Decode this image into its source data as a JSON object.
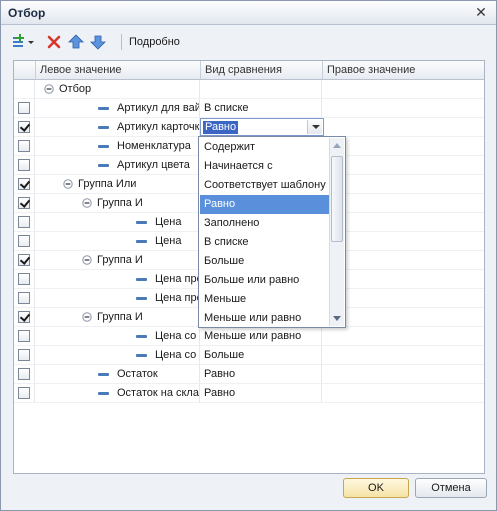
{
  "window": {
    "title": "Отбор"
  },
  "toolbar": {
    "details_label": "Подробно"
  },
  "grid": {
    "columns": [
      "Левое значение",
      "Вид сравнения",
      "Правое значение"
    ],
    "rows": [
      {
        "level": 0,
        "kind": "group",
        "expand": "collapse",
        "checkbox": false,
        "checked": false,
        "left": "Отбор",
        "cmp": ""
      },
      {
        "level": 1,
        "kind": "item",
        "checkbox": true,
        "checked": false,
        "left": "Артикул для вайлд...",
        "cmp": "В списке"
      },
      {
        "level": 1,
        "kind": "item",
        "checkbox": true,
        "checked": true,
        "left": "Артикул карточки",
        "cmp": "Равно",
        "editing": true
      },
      {
        "level": 1,
        "kind": "item",
        "checkbox": true,
        "checked": false,
        "left": "Номенклатура",
        "cmp": ""
      },
      {
        "level": 1,
        "kind": "item",
        "checkbox": true,
        "checked": false,
        "left": "Артикул цвета",
        "cmp": ""
      },
      {
        "level": 1,
        "kind": "group",
        "expand": "collapse",
        "checkbox": true,
        "checked": true,
        "left": "Группа Или",
        "cmp": ""
      },
      {
        "level": 2,
        "kind": "group",
        "expand": "collapse",
        "checkbox": true,
        "checked": true,
        "left": "Группа И",
        "cmp": ""
      },
      {
        "level": 3,
        "kind": "item",
        "checkbox": true,
        "checked": false,
        "left": "Цена",
        "cmp": ""
      },
      {
        "level": 3,
        "kind": "item",
        "checkbox": true,
        "checked": false,
        "left": "Цена",
        "cmp": ""
      },
      {
        "level": 2,
        "kind": "group",
        "expand": "collapse",
        "checkbox": true,
        "checked": true,
        "left": "Группа И",
        "cmp": ""
      },
      {
        "level": 3,
        "kind": "item",
        "checkbox": true,
        "checked": false,
        "left": "Цена про...",
        "cmp": ""
      },
      {
        "level": 3,
        "kind": "item",
        "checkbox": true,
        "checked": false,
        "left": "Цена про...",
        "cmp": ""
      },
      {
        "level": 2,
        "kind": "group",
        "expand": "collapse",
        "checkbox": true,
        "checked": true,
        "left": "Группа И",
        "cmp": ""
      },
      {
        "level": 3,
        "kind": "item",
        "checkbox": true,
        "checked": false,
        "left": "Цена со с...",
        "cmp": "Меньше или равно"
      },
      {
        "level": 3,
        "kind": "item",
        "checkbox": true,
        "checked": false,
        "left": "Цена со с...",
        "cmp": "Больше"
      },
      {
        "level": 1,
        "kind": "item",
        "checkbox": true,
        "checked": false,
        "left": "Остаток",
        "cmp": "Равно"
      },
      {
        "level": 1,
        "kind": "item",
        "checkbox": true,
        "checked": false,
        "left": "Остаток на скла...",
        "cmp": "Равно"
      }
    ]
  },
  "dropdown": {
    "items": [
      "Содержит",
      "Начинается с",
      "Соответствует шаблону",
      "Равно",
      "Заполнено",
      "В списке",
      "Больше",
      "Больше или равно",
      "Меньше",
      "Меньше или равно"
    ],
    "selected": "Равно"
  },
  "buttons": {
    "ok": "OK",
    "cancel": "Отмена"
  },
  "colors": {
    "accent": "#3b66c4",
    "highlight": "#5a8fdc",
    "icon_blue": "#4a7ab8"
  }
}
